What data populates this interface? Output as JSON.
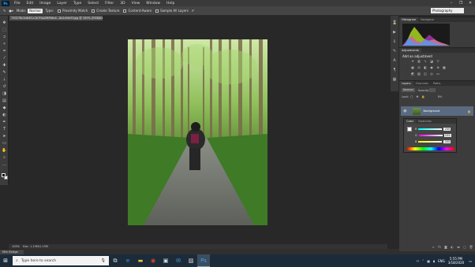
{
  "app": {
    "logo": "Ps",
    "menu": [
      "File",
      "Edit",
      "Image",
      "Layer",
      "Type",
      "Select",
      "Filter",
      "3D",
      "View",
      "Window",
      "Help"
    ],
    "window_controls": [
      "–",
      "❐",
      "✕"
    ]
  },
  "options": {
    "mode_label": "Mode:",
    "mode_value": "Normal",
    "type_label": "Type:",
    "proximity_match": "Proximity Match",
    "create_texture": "Create Texture",
    "content_aware": "Content-Aware",
    "sample_all_layers": "Sample All Layers",
    "workspace": "Photography"
  },
  "document": {
    "tab_title": "730278c3d64f1c2b7f4a2f6f9db4...8a1ef4e5f.jpg @ 100% (RGB/8#)",
    "zoom": "100%",
    "doc_info": "Doc: 1.15M/1.15M"
  },
  "mini_bridge": "Mini Bridge",
  "panels": {
    "histogram_tabs": [
      "Histogram",
      "Navigator"
    ],
    "adjustments_tab": "Adjustments",
    "adjustments_title": "Add an adjustment",
    "layers_tabs": [
      "Layers",
      "Channels",
      "Paths"
    ],
    "kind": "Normal",
    "opacity_label": "Opacity:",
    "opacity_value": "",
    "lock_label": "Lock:",
    "fill_label": "Fill:",
    "bg_layer_name": "Background",
    "color_tabs": [
      "Color",
      "Swatches"
    ],
    "rgb": [
      {
        "channel": "R",
        "value": "255",
        "color": "#ff6060"
      },
      {
        "channel": "G",
        "value": "255",
        "color": "#60ff60"
      },
      {
        "channel": "B",
        "value": "255",
        "color": "#6060ff"
      }
    ]
  },
  "taskbar": {
    "search_placeholder": "Type here to search",
    "lang": "ENG",
    "time": "5:55 PM",
    "date": "3/18/2020"
  }
}
